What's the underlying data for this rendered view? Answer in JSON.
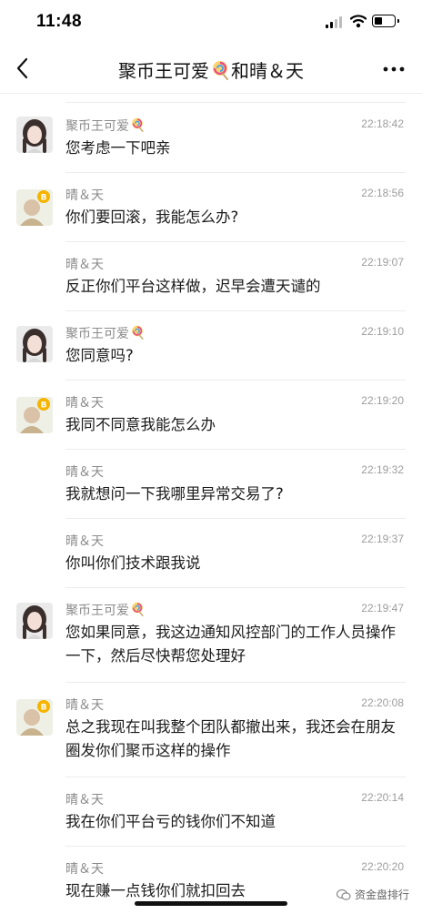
{
  "status": {
    "time": "11:48"
  },
  "header": {
    "title_prefix": "聚币王可爱",
    "title_suffix": "和晴＆天"
  },
  "messages": [
    {
      "sender": "聚币王可爱",
      "time": "22:18:42",
      "text": "您考虑一下吧亲"
    },
    {
      "sender": "晴＆天",
      "time": "22:18:56",
      "text": "你们要回滚，我能怎么办?"
    },
    {
      "sender": "晴＆天",
      "time": "22:19:07",
      "text": "反正你们平台这样做，迟早会遭天谴的"
    },
    {
      "sender": "聚币王可爱",
      "time": "22:19:10",
      "text": "您同意吗?"
    },
    {
      "sender": "晴＆天",
      "time": "22:19:20",
      "text": "我同不同意我能怎么办"
    },
    {
      "sender": "晴＆天",
      "time": "22:19:32",
      "text": "我就想问一下我哪里异常交易了?"
    },
    {
      "sender": "晴＆天",
      "time": "22:19:37",
      "text": "你叫你们技术跟我说"
    },
    {
      "sender": "聚币王可爱",
      "time": "22:19:47",
      "text": "您如果同意，我这边通知风控部门的工作人员操作一下，然后尽快帮您处理好"
    },
    {
      "sender": "晴＆天",
      "time": "22:20:08",
      "text": "总之我现在叫我整个团队都撤出来，我还会在朋友圈发你们聚币这样的操作"
    },
    {
      "sender": "晴＆天",
      "time": "22:20:14",
      "text": "我在你们平台亏的钱你们不知道"
    },
    {
      "sender": "晴＆天",
      "time": "22:20:20",
      "text": "现在赚一点钱你们就扣回去"
    }
  ],
  "watermark": {
    "text": "资金盘排行"
  }
}
